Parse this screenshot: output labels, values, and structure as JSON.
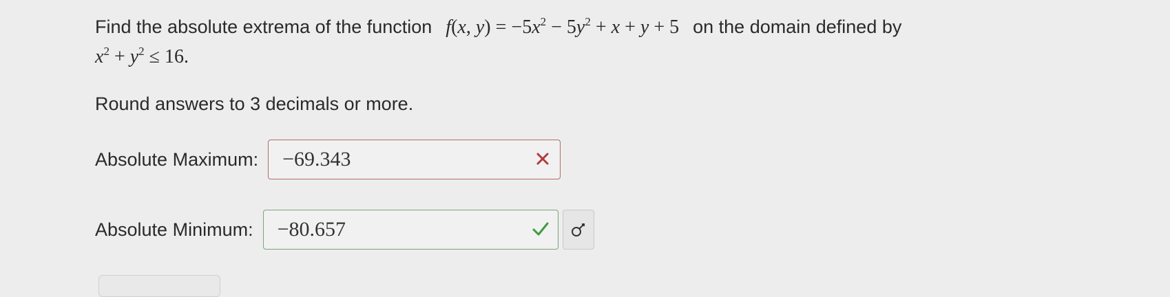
{
  "question": {
    "intro": "Find the absolute extrema of the function",
    "function_text": "f(x, y) = −5x2 − 5y2 + x + y + 5",
    "domain_intro": "on the domain defined by",
    "domain_text": "x2 + y2 ≤ 16.",
    "round_instruction": "Round answers to 3 decimals or more."
  },
  "answers": [
    {
      "label": "Absolute Maximum:",
      "value": "−69.343",
      "status": "incorrect",
      "status_icon": "x-mark-icon"
    },
    {
      "label": "Absolute Minimum:",
      "value": "−80.657",
      "status": "correct",
      "status_icon": "check-mark-icon"
    }
  ],
  "key_button_icon": "key-icon",
  "colors": {
    "incorrect": "#b23a3a",
    "correct": "#3f9a3f",
    "background": "#ededed"
  }
}
